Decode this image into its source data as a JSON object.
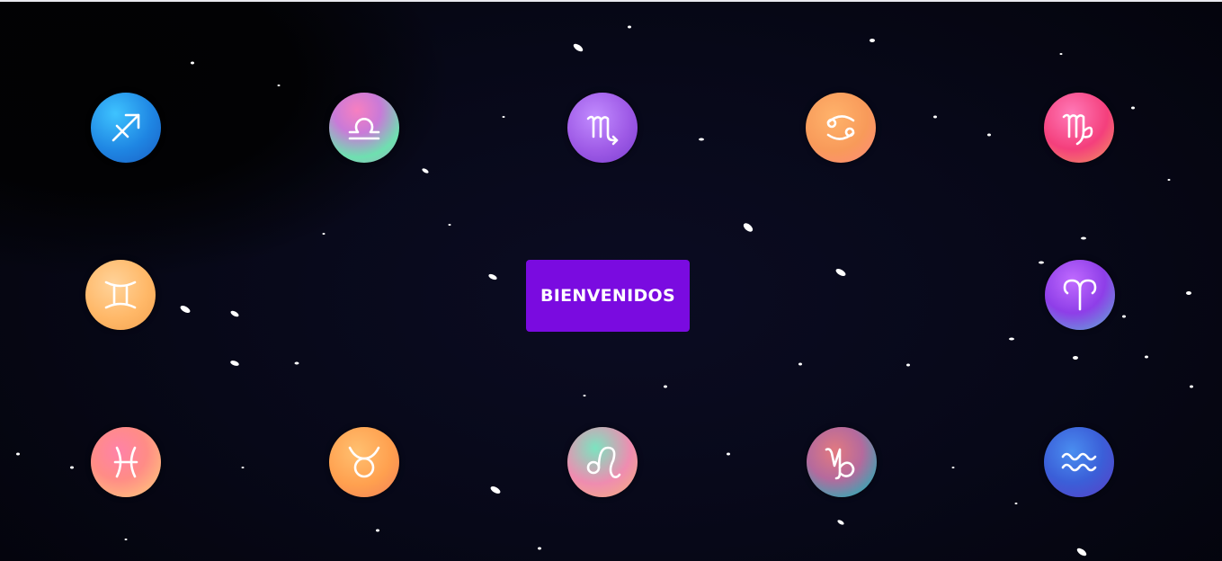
{
  "welcome_button": {
    "label": "BIENVENIDOS",
    "color": "#7a0be0"
  },
  "zodiac_signs": [
    {
      "name": "sagittarius",
      "icon": "sagittarius-icon"
    },
    {
      "name": "libra",
      "icon": "libra-icon"
    },
    {
      "name": "scorpio",
      "icon": "scorpio-icon"
    },
    {
      "name": "cancer",
      "icon": "cancer-icon"
    },
    {
      "name": "virgo",
      "icon": "virgo-icon"
    },
    {
      "name": "gemini",
      "icon": "gemini-icon"
    },
    {
      "name": "aries",
      "icon": "aries-icon"
    },
    {
      "name": "pisces",
      "icon": "pisces-icon"
    },
    {
      "name": "taurus",
      "icon": "taurus-icon"
    },
    {
      "name": "leo",
      "icon": "leo-icon"
    },
    {
      "name": "capricorn",
      "icon": "capricorn-icon"
    },
    {
      "name": "aquarius",
      "icon": "aquarius-icon"
    }
  ],
  "colors": {
    "background": "#05050d",
    "star": "#ffffff"
  }
}
